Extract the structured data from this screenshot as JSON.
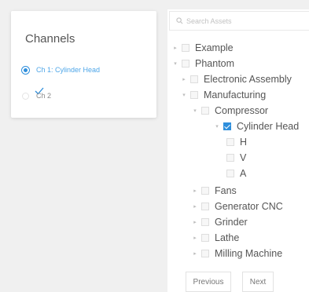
{
  "channels": {
    "title": "Channels",
    "items": [
      {
        "label": "Ch 1: Cylinder Head",
        "selected": true
      },
      {
        "label": "Ch 2",
        "selected": false
      }
    ]
  },
  "assets": {
    "search_placeholder": "Search Assets",
    "tree": [
      {
        "label": "Example"
      },
      {
        "label": "Phantom"
      },
      {
        "label": "Electronic Assembly"
      },
      {
        "label": "Manufacturing"
      },
      {
        "label": "Compressor"
      },
      {
        "label": "Cylinder Head",
        "checked": true
      },
      {
        "label": "H"
      },
      {
        "label": "V"
      },
      {
        "label": "A"
      },
      {
        "label": "Fans"
      },
      {
        "label": "Generator CNC"
      },
      {
        "label": "Grinder"
      },
      {
        "label": "Lathe"
      },
      {
        "label": "Milling Machine"
      }
    ]
  },
  "pagination": {
    "previous_label": "Previous",
    "next_label": "Next"
  },
  "colors": {
    "accent": "#2f8fdc"
  }
}
